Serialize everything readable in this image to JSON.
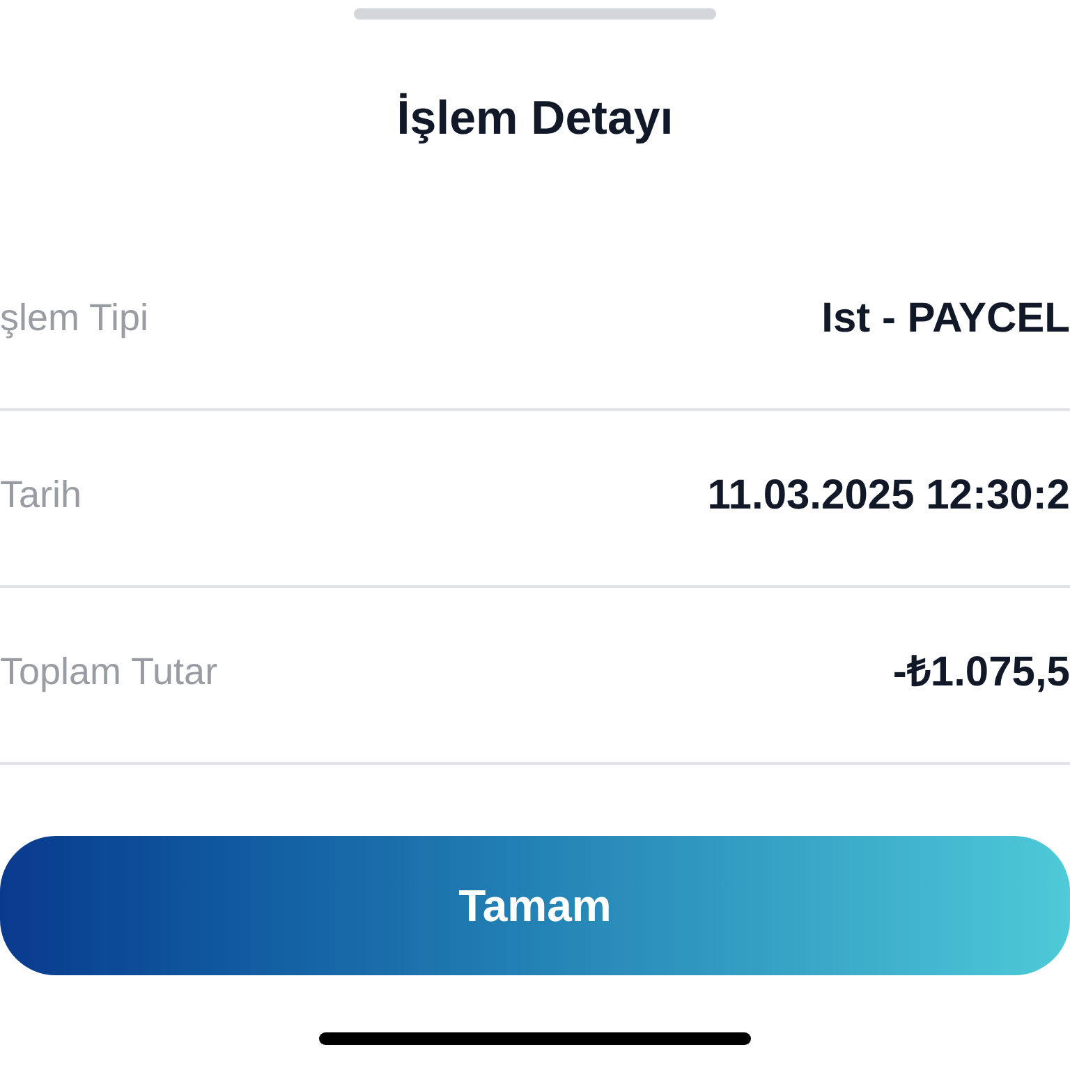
{
  "title": "İşlem Detayı",
  "rows": [
    {
      "label": "şlem Tipi",
      "value": "Ist - PAYCEL"
    },
    {
      "label": "Tarih",
      "value": "11.03.2025 12:30:2"
    },
    {
      "label": "Toplam Tutar",
      "value": "-₺1.075,5"
    }
  ],
  "button": "Tamam"
}
